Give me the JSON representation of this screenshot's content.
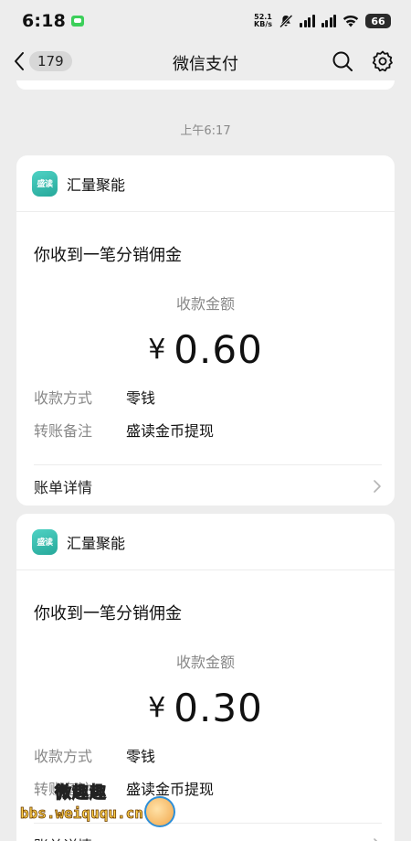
{
  "status": {
    "time": "6:18",
    "net_speed_value": "52.1",
    "net_speed_unit": "KB/s",
    "battery": "66"
  },
  "nav": {
    "unread_count": "179",
    "title": "微信支付"
  },
  "timestamp": "上午6:17",
  "cards": [
    {
      "sender": "汇量聚能",
      "logo_text": "盛读",
      "title": "你收到一笔分销佣金",
      "amount_label": "收款金额",
      "currency": "¥",
      "amount": "0.60",
      "method_key": "收款方式",
      "method_value": "零钱",
      "note_key": "转账备注",
      "note_value": "盛读金币提现",
      "detail_label": "账单详情"
    },
    {
      "sender": "汇量聚能",
      "logo_text": "盛读",
      "title": "你收到一笔分销佣金",
      "amount_label": "收款金额",
      "currency": "¥",
      "amount": "0.30",
      "method_key": "收款方式",
      "method_value": "零钱",
      "note_key": "转账备注",
      "note_value": "盛读金币提现",
      "detail_label": "账单详情"
    }
  ],
  "watermark": {
    "title": "微趣趣",
    "url": "bbs.weiququ.cn"
  }
}
